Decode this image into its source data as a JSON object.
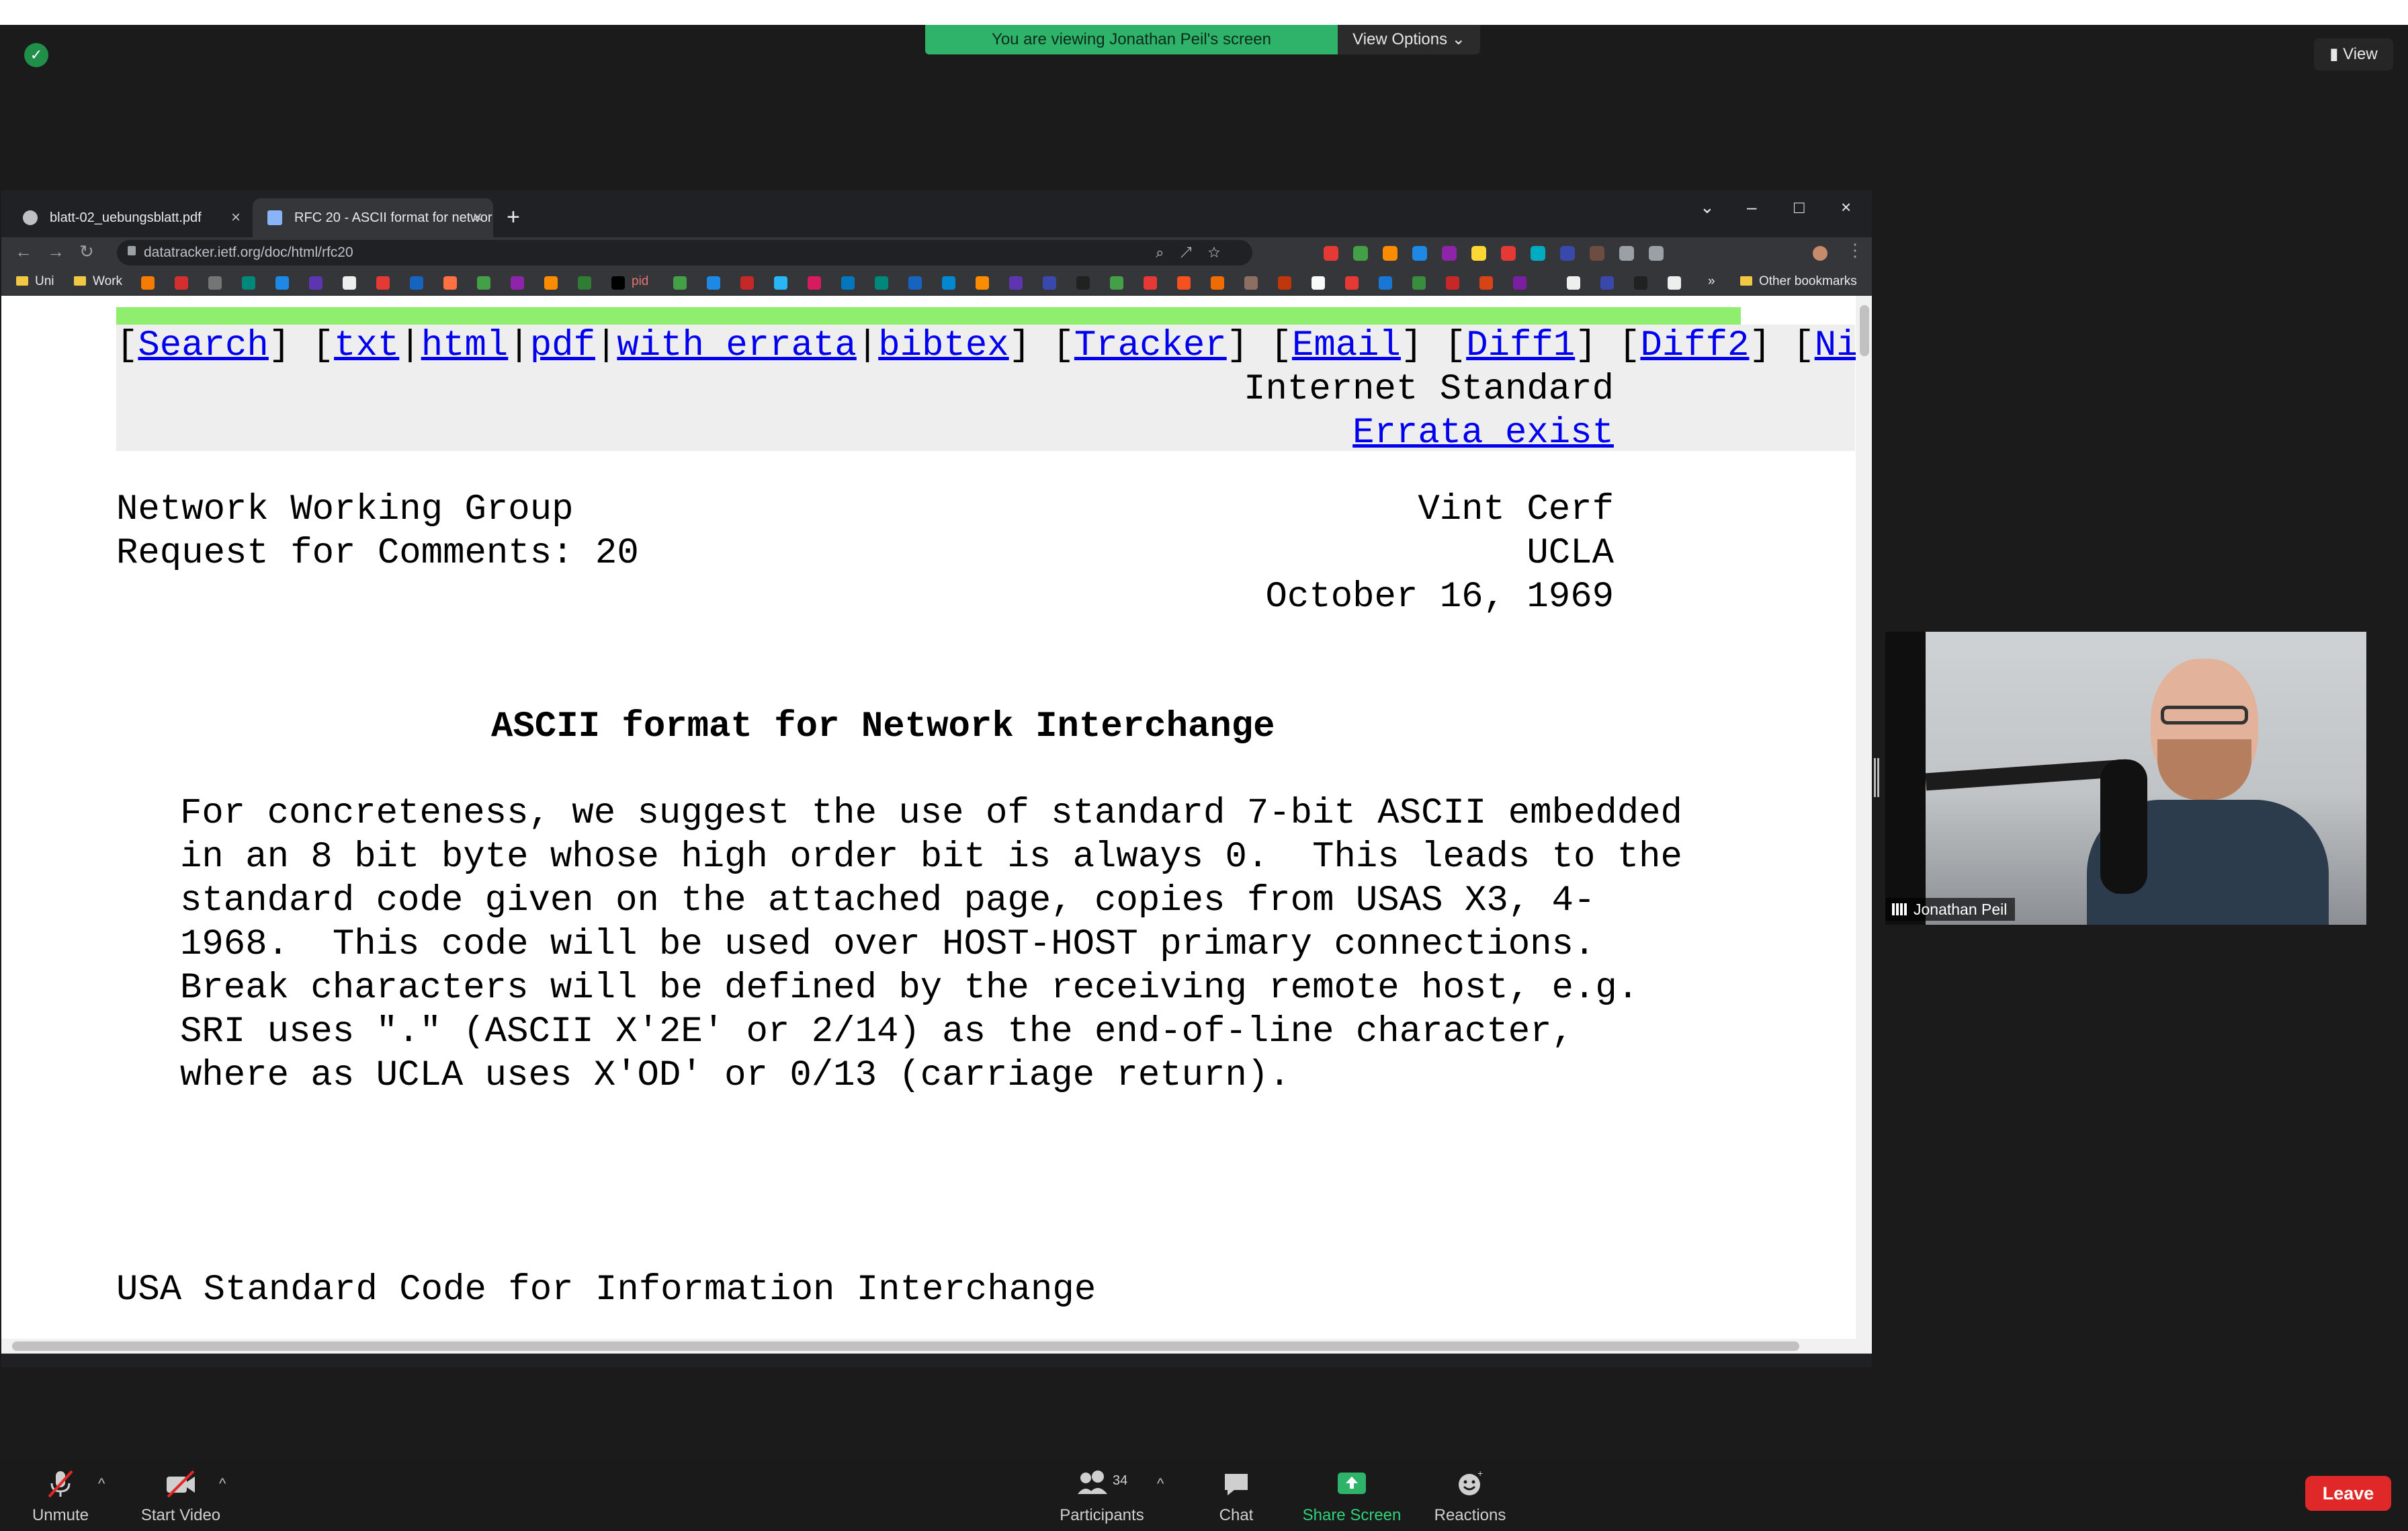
{
  "zoom": {
    "banner_text": "You are viewing Jonathan Peil's screen",
    "view_options_label": "View Options",
    "view_button_label": "View",
    "participant_name": "Jonathan Peil",
    "controls": {
      "unmute": "Unmute",
      "start_video": "Start Video",
      "participants": "Participants",
      "participants_count": "34",
      "chat": "Chat",
      "share_screen": "Share Screen",
      "reactions": "Reactions",
      "leave": "Leave"
    },
    "colors": {
      "banner": "#2fb36b",
      "leave": "#e02828",
      "share": "#2fb36b"
    }
  },
  "browser": {
    "tabs": [
      {
        "label": "blatt-02_uebungsblatt.pdf",
        "active": false
      },
      {
        "label": "RFC 20 - ASCII format for networ",
        "active": true
      }
    ],
    "url": "datatracker.ietf.org/doc/html/rfc20",
    "bookmarks": {
      "uni": "Uni",
      "work": "Work",
      "pid": "pid",
      "other": "Other bookmarks"
    }
  },
  "rfc": {
    "links": {
      "search": "Search",
      "txt": "txt",
      "html": "html",
      "pdf": "pdf",
      "with_errata": "with errata",
      "bibtex": "bibtex",
      "tracker": "Tracker",
      "email": "Email",
      "diff1": "Diff1",
      "diff2": "Diff2",
      "nits": "Nits"
    },
    "status": "Internet Standard",
    "errata": "Errata exist",
    "header_left": [
      "Network Working Group",
      "Request for Comments: 20"
    ],
    "header_right": [
      "Vint Cerf",
      "UCLA",
      "October 16, 1969"
    ],
    "title": "ASCII format for Network Interchange",
    "body": [
      "For concreteness, we suggest the use of standard 7-bit ASCII embedded",
      "in an 8 bit byte whose high order bit is always 0.  This leads to the",
      "standard code given on the attached page, copies from USAS X3, 4-",
      "1968.  This code will be used over HOST-HOST primary connections.",
      "Break characters will be defined by the receiving remote host, e.g.",
      "SRI uses \".\" (ASCII X'2E' or 2/14) as the end-of-line character,",
      "where as UCLA uses X'OD' or 0/13 (carriage return)."
    ],
    "section_heading": "USA Standard Code for Information Interchange"
  }
}
